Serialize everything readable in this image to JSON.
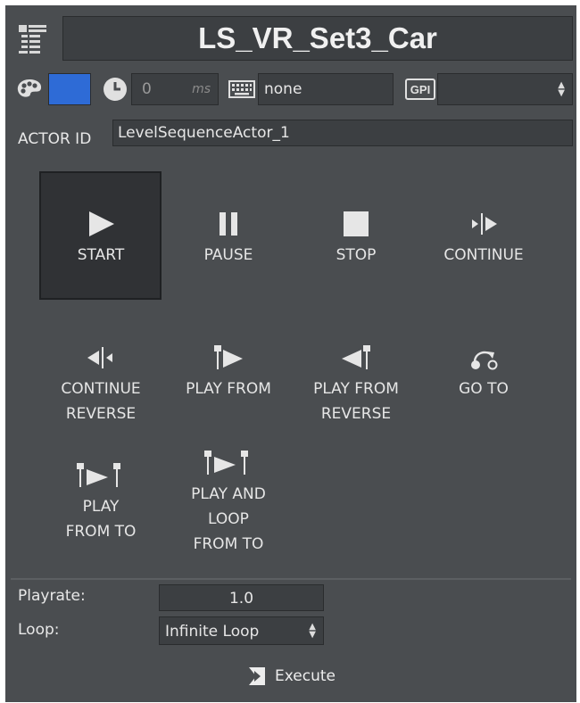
{
  "header": {
    "title": "LS_VR_Set3_Car"
  },
  "toolbar": {
    "color_swatch": "#2e6bd6",
    "delay_value": "0",
    "delay_unit": "ms",
    "keyboard_value": "none",
    "gpi_value": ""
  },
  "actor": {
    "label": "ACTOR ID",
    "value": "LevelSequenceActor_1"
  },
  "actions": [
    {
      "label": "START"
    },
    {
      "label": "PAUSE"
    },
    {
      "label": "STOP"
    },
    {
      "label": "CONTINUE"
    },
    {
      "label": "CONTINUE\nREVERSE"
    },
    {
      "label": "PLAY FROM"
    },
    {
      "label": "PLAY FROM\nREVERSE"
    },
    {
      "label": "GO TO"
    },
    {
      "label": "PLAY\nFROM TO"
    },
    {
      "label": "PLAY AND\nLOOP\nFROM TO"
    }
  ],
  "settings": {
    "playrate_label": "Playrate:",
    "playrate_value": "1.0",
    "loop_label": "Loop:",
    "loop_value": "Infinite Loop"
  },
  "execute": {
    "label": "Execute"
  },
  "icons": [
    "tree-list-icon",
    "palette-icon",
    "clock-icon",
    "keyboard-icon",
    "gpi-icon",
    "play-icon",
    "pause-icon",
    "stop-icon",
    "continue-icon",
    "continue-reverse-icon",
    "play-from-icon",
    "play-from-reverse-icon",
    "go-to-icon",
    "play-from-to-icon",
    "play-loop-from-to-icon",
    "execute-icon"
  ]
}
